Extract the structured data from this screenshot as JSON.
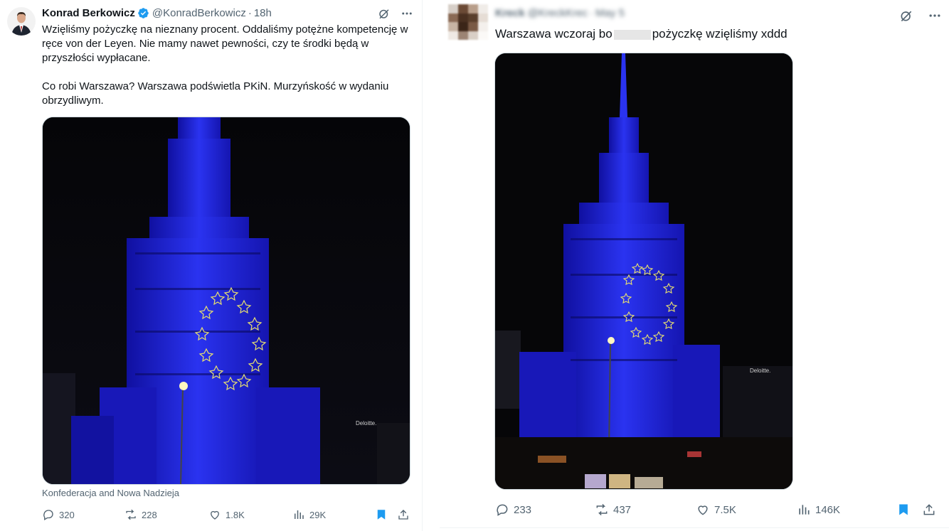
{
  "left": {
    "author_name": "Konrad Berkowicz",
    "handle": "@KonradBerkowicz",
    "separator": "·",
    "time": "18h",
    "text": "Wzięliśmy pożyczkę na nieznany procent. Oddaliśmy potężne kompetencję w ręce von der Leyen. Nie mamy nawet pewności, czy te środki będą w przyszłości wypłacane.\n\nCo robi Warszawa? Warszawa podświetla PKiN. Murzyńskość w wydaniu obrzydliwym.",
    "caption": "Konfederacja and Nowa Nadzieja",
    "replies": "320",
    "reposts": "228",
    "likes": "1.8K",
    "views": "29K",
    "sign_text": "Deloitte."
  },
  "right": {
    "author_name": "Kreck",
    "handle": "@KreckKrec",
    "time": "May 5",
    "text_before": "Warszawa wczoraj bo",
    "text_after": "pożyczkę wzięliśmy xddd",
    "replies": "233",
    "reposts": "437",
    "likes": "7.5K",
    "views": "146K",
    "sign_text": "Deloitte."
  },
  "colors": {
    "accent": "#1d9bf0",
    "secondary_text": "#536471",
    "building_blue": "#1a22d6",
    "star_yellow": "#e8e070"
  },
  "icons": [
    "verified-badge-icon",
    "grok-icon",
    "more-icon",
    "reply-icon",
    "repost-icon",
    "like-icon",
    "views-icon",
    "bookmark-icon",
    "share-icon"
  ]
}
